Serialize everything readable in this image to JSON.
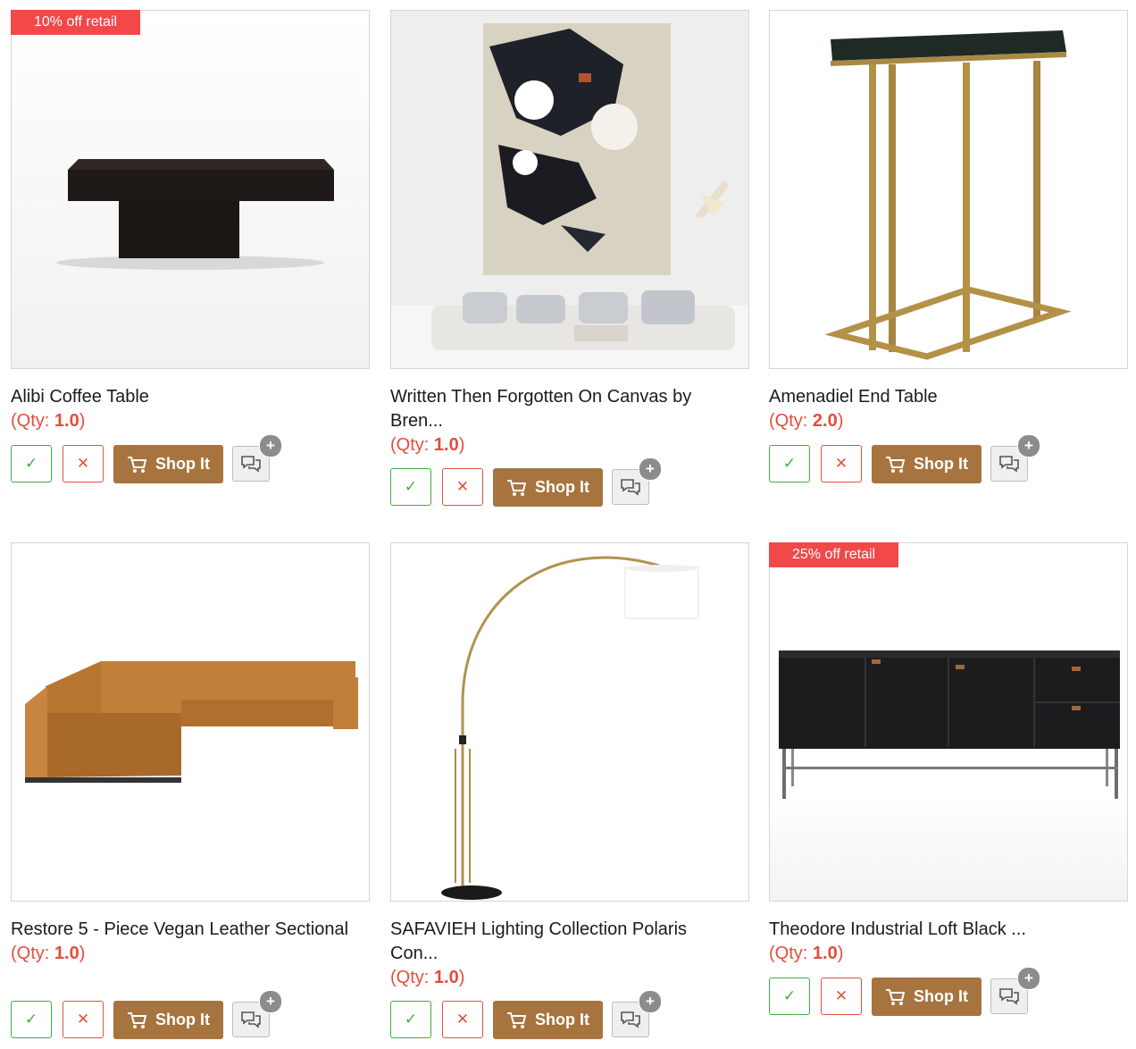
{
  "products": [
    {
      "badge": "10% off retail",
      "title": "Alibi Coffee Table",
      "qty_label": "(Qty: ",
      "qty_value": "1.0",
      "qty_close": ")",
      "image": "black-coffee-table"
    },
    {
      "badge": "",
      "title": "Written Then Forgotten On Canvas by Bren...",
      "qty_label": "(Qty: ",
      "qty_value": "1.0",
      "qty_close": ")",
      "image": "abstract-canvas-art"
    },
    {
      "badge": "",
      "title": "Amenadiel End Table",
      "qty_label": "(Qty: ",
      "qty_value": "2.0",
      "qty_close": ")",
      "image": "marble-brass-end-table"
    },
    {
      "badge": "",
      "title": "Restore 5 - Piece Vegan Leather Sectional",
      "qty_label": "(Qty: ",
      "qty_value": "1.0",
      "qty_close": ")",
      "image": "leather-sectional-sofa"
    },
    {
      "badge": "",
      "title": "SAFAVIEH Lighting Collection Polaris Con...",
      "qty_label": "(Qty: ",
      "qty_value": "1.0",
      "qty_close": ")",
      "image": "arc-floor-lamp"
    },
    {
      "badge": "25% off retail",
      "title": "Theodore Industrial Loft Black ...",
      "qty_label": "(Qty: ",
      "qty_value": "1.0",
      "qty_close": ")",
      "image": "black-sideboard"
    }
  ],
  "actions": {
    "approve_icon": "check-icon",
    "reject_icon": "x-icon",
    "shop_label": "Shop It",
    "shop_icon": "cart-icon",
    "comment_icon": "chat-bubbles-icon",
    "comment_badge": "+"
  },
  "colors": {
    "badge": "#f24848",
    "qty": "#e64c3c",
    "shop_button": "#a7743f",
    "approve": "#3fae3f",
    "reject": "#e0533f"
  }
}
